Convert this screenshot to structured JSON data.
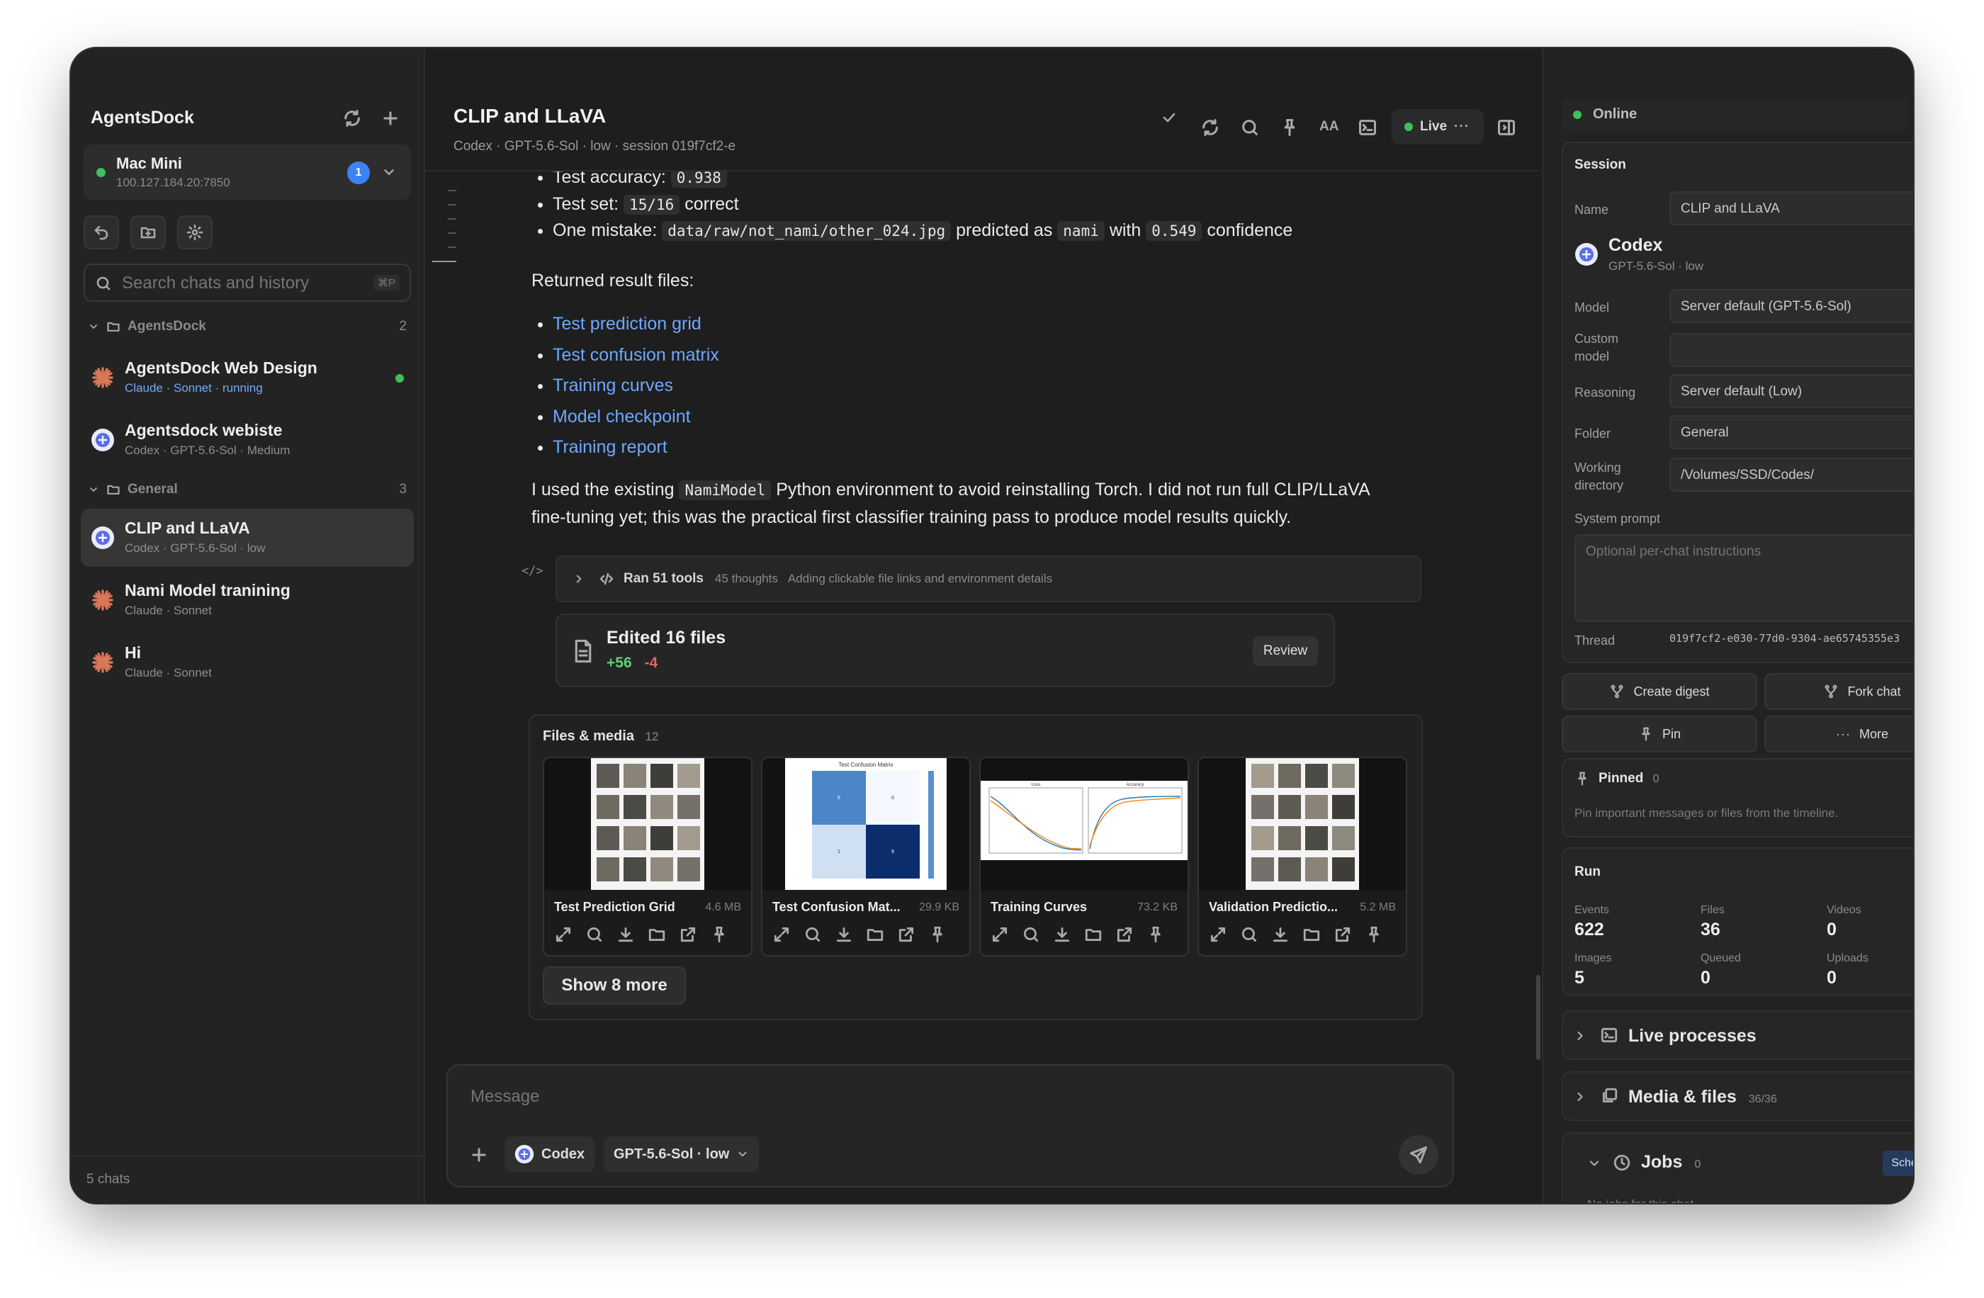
{
  "sidebar": {
    "app_title": "AgentsDock",
    "device": {
      "name": "Mac Mini",
      "address": "100.127.184.20:7850",
      "badge": "1"
    },
    "search": {
      "placeholder": "Search chats and history",
      "shortcut": "⌘P"
    },
    "groups": [
      {
        "name": "AgentsDock",
        "count": "2",
        "chats": [
          {
            "title": "AgentsDock Web Design",
            "agent": "Claude",
            "model": "Sonnet",
            "status": "running"
          },
          {
            "title": "Agentsdock webiste",
            "subtitle": "Codex · GPT-5.6-Sol · Medium"
          }
        ]
      },
      {
        "name": "General",
        "count": "3",
        "chats": [
          {
            "title": "CLIP and LLaVA",
            "subtitle": "Codex · GPT-5.6-Sol · low"
          },
          {
            "title": "Nami Model tranining",
            "subtitle": "Claude · Sonnet"
          },
          {
            "title": "Hi",
            "subtitle": "Claude · Sonnet"
          }
        ]
      }
    ],
    "footer": "5 chats"
  },
  "header": {
    "title": "CLIP and LLaVA",
    "subtitle": "Codex · GPT-5.6-Sol · low · session 019f7cf2-e",
    "live_label": "Live"
  },
  "message": {
    "line_accuracy_label": "Test accuracy:",
    "line_accuracy_value": "0.938",
    "line_testset_label": "Test set:",
    "line_testset_value": "15/16",
    "line_testset_suffix": "correct",
    "mistake_prefix": "One mistake:",
    "mistake_path": "data/raw/not_nami/other_024.jpg",
    "mistake_mid": "predicted as",
    "mistake_class": "nami",
    "mistake_with": "with",
    "mistake_conf": "0.549",
    "mistake_suffix": "confidence",
    "returned_heading": "Returned result files:",
    "result_links": [
      "Test prediction grid",
      "Test confusion matrix",
      "Training curves",
      "Model checkpoint",
      "Training report"
    ],
    "para_1": "I used the existing",
    "para_code": "NamiModel",
    "para_2": "Python environment to avoid reinstalling Torch. I did not run full CLIP/LLaVA",
    "para_3": "fine-tuning yet; this was the practical first classifier training pass to produce model results quickly."
  },
  "tools": {
    "label": "Ran 51 tools",
    "thoughts": "45 thoughts",
    "summary": "Adding clickable file links and environment details",
    "code_glyph": "</>"
  },
  "edits": {
    "title": "Edited 16 files",
    "added": "+56",
    "removed": "-4",
    "review_label": "Review"
  },
  "files_media": {
    "title": "Files & media",
    "count": "12",
    "items": [
      {
        "name": "Test Prediction Grid",
        "size": "4.6 MB"
      },
      {
        "name": "Test Confusion Mat...",
        "size": "29.9 KB"
      },
      {
        "name": "Training Curves",
        "size": "73.2 KB"
      },
      {
        "name": "Validation Predictio...",
        "size": "5.2 MB"
      }
    ],
    "show_more": "Show 8 more",
    "confusion_title": "Test Confusion Matrix",
    "curves_titles": [
      "Loss",
      "Accuracy"
    ]
  },
  "composer": {
    "placeholder": "Message",
    "agent": "Codex",
    "model": "GPT-5.6-Sol · low"
  },
  "right": {
    "status": "Online",
    "session": {
      "title": "Session",
      "name_label": "Name",
      "name_value": "CLIP and LLaVA",
      "agent": "Codex",
      "agent_sub": "GPT-5.6-Sol · low",
      "model_label": "Model",
      "model_value": "Server default (GPT-5.6-Sol)",
      "custom_label_1": "Custom",
      "custom_label_2": "model",
      "reasoning_label": "Reasoning",
      "reasoning_value": "Server default (Low)",
      "folder_label": "Folder",
      "folder_value": "General",
      "wd_label_1": "Working",
      "wd_label_2": "directory",
      "wd_value": "/Volumes/SSD/Codes/",
      "prompt_label": "System prompt",
      "prompt_placeholder": "Optional per-chat instructions",
      "thread_label": "Thread",
      "thread_value": "019f7cf2-e030-77d0-9304-ae65745355e3"
    },
    "actions": {
      "digest": "Create digest",
      "fork": "Fork chat",
      "pin": "Pin",
      "more": "More"
    },
    "pinned": {
      "title": "Pinned",
      "count": "0",
      "hint": "Pin important messages or files from the timeline."
    },
    "run": {
      "title": "Run",
      "stats": [
        {
          "label": "Events",
          "value": "622"
        },
        {
          "label": "Files",
          "value": "36"
        },
        {
          "label": "Videos",
          "value": "0"
        },
        {
          "label": "Images",
          "value": "5"
        },
        {
          "label": "Queued",
          "value": "0"
        },
        {
          "label": "Uploads",
          "value": "0"
        }
      ]
    },
    "live_processes": "Live processes",
    "media_files": {
      "title": "Media & files",
      "count": "36/36"
    },
    "jobs": {
      "title": "Jobs",
      "count": "0",
      "schedule": "Schedule",
      "empty": "No jobs for this chat"
    }
  },
  "colors": {
    "accent_link": "#6ea8ff",
    "online_green": "#3fbf5a",
    "added": "#5fcf7a",
    "removed": "#e06666",
    "badge_blue": "#3b82f6"
  }
}
